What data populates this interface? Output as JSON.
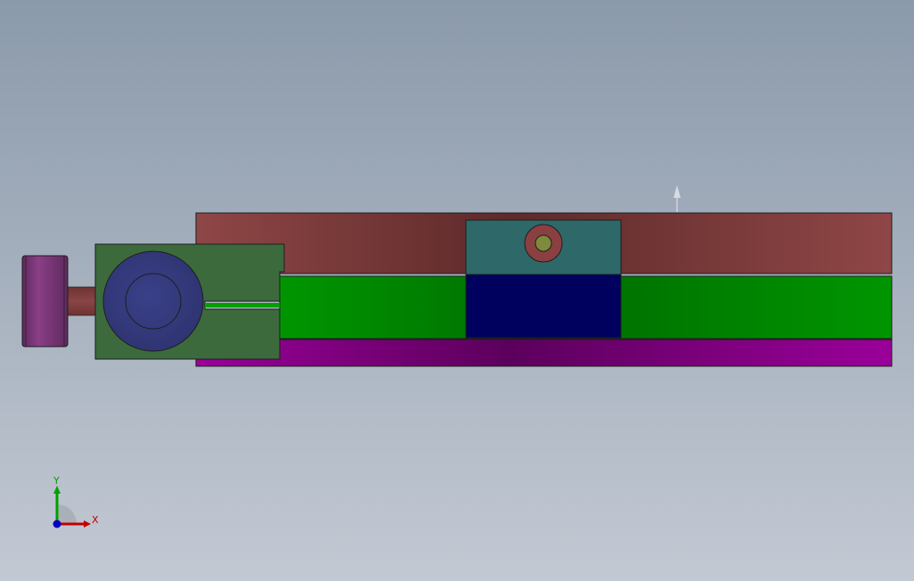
{
  "scene": {
    "colors": {
      "background_top": "#8b9aab",
      "background_bottom": "#c3c9d3",
      "top_rail": "#8f4646",
      "top_rail_dark": "#5e2a2a",
      "middle_rail": "#009600",
      "middle_rail_dark": "#006b00",
      "bottom_rail": "#9a009a",
      "bottom_rail_dark": "#5c005c",
      "carriage_top": "#2f6868",
      "carriage_bottom": "#00005e",
      "bolt_outer": "#8a4040",
      "bolt_inner": "#7f8a3c",
      "end_block": "#3c6a3c",
      "end_block_disc": "#2e3470",
      "knob": "#8a3e86",
      "shaft": "#8a4545"
    },
    "icons": {
      "direction_arrow": "arrow-up-icon"
    }
  },
  "triad": {
    "y_label": "Y",
    "x_label": "X",
    "colors": {
      "x": "#c00000",
      "y": "#00a000",
      "z": "#0000c0"
    }
  }
}
